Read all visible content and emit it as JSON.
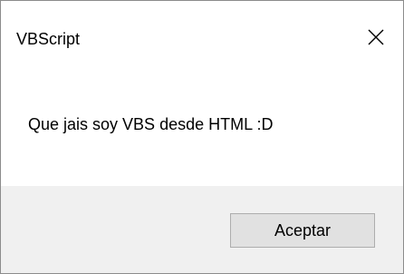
{
  "window": {
    "title": "VBScript",
    "close_icon": "close-icon"
  },
  "message": {
    "text": "Que jais soy VBS desde HTML :D"
  },
  "buttons": {
    "ok_label": "Aceptar"
  },
  "colors": {
    "footer_background": "#f0f0f0",
    "button_background": "#e1e1e1",
    "button_border": "#adadad",
    "window_border": "#8c8c8c"
  }
}
